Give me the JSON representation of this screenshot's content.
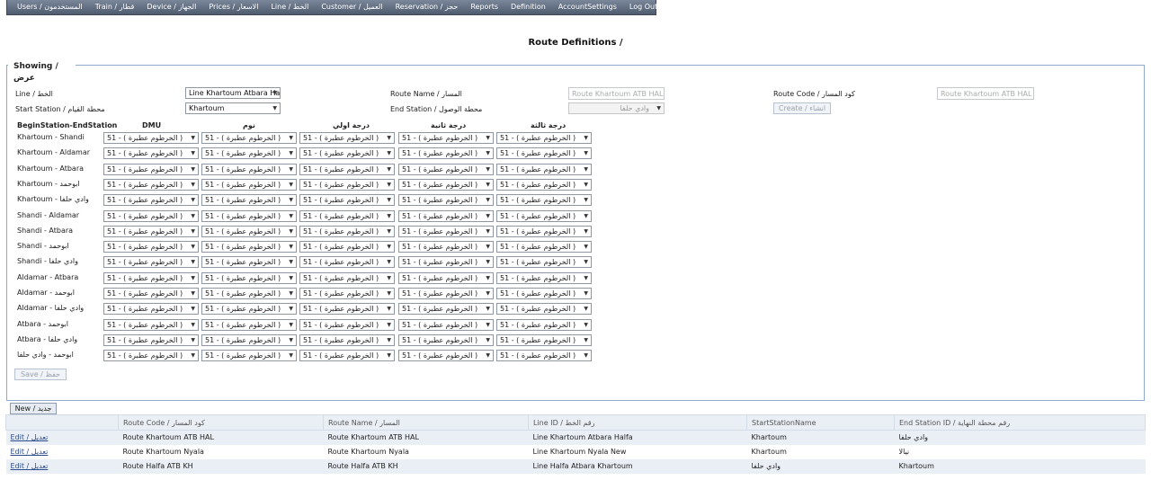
{
  "menu": [
    "Users / المستخدمون",
    "Train / قطار",
    "Device / الجهاز",
    "Prices / الاسعار",
    "Line / الخط",
    "Customer / العميل",
    "Reservation / حجز",
    "Reports",
    "Definition",
    "AccountSettings",
    "Log Out / خروج"
  ],
  "page_title": "Route Definitions /",
  "showing": {
    "legend": "Showing / عرض"
  },
  "form": {
    "line_label": "Line / الخط",
    "line_value": "Line Khartoum Atbara Ha",
    "route_name_label": "Route Name / المسار",
    "route_name_placeholder": "Route Khartoum ATB HAL",
    "route_code_label": "Route Code / كود المسار",
    "route_code_placeholder": "Route Khartoum ATB HAL",
    "start_station_label": "Start Station / محطة القيام",
    "start_station_value": "Khartoum",
    "end_station_label": "End Station / محطة الوصول",
    "end_station_value": "وادي حلفا",
    "create_button": "Create / انشاء",
    "save_button": "Save / حفظ"
  },
  "grid": {
    "headers": [
      "BeginStation-EndStation",
      "DMU",
      "نوم",
      "درجة اولي",
      "درجة ثانية",
      "درجة ثالثة"
    ],
    "cell_value": "51 - ( الخرطوم عطبرة )",
    "rows": [
      "Khartoum - Shandi",
      "Khartoum - Aldamar",
      "Khartoum - Atbara",
      "Khartoum - ابوحمد",
      "Khartoum - وادي حلفا",
      "Shandi - Aldamar",
      "Shandi - Atbara",
      "Shandi - ابوحمد",
      "Shandi - وادي حلفا",
      "Aldamar - Atbara",
      "Aldamar - ابوحمد",
      "Aldamar - وادي حلفا",
      "Atbara - ابوحمد",
      "Atbara - وادي حلفا",
      "ابوحمد - وادي حلفا"
    ]
  },
  "new_button": "New / جديد",
  "results": {
    "headers": [
      "",
      "Route Code / كود المسار",
      "Route Name / المسار",
      "Line ID / رقم الخط",
      "StartStationName",
      "End Station ID / رقم محطة النهاية"
    ],
    "rows": [
      [
        "Edit / تعديل",
        "Route Khartoum ATB HAL",
        "Route Khartoum ATB HAL",
        "Line Khartoum Atbara Halfa",
        "Khartoum",
        "وادي حلفا"
      ],
      [
        "Edit / تعديل",
        "Route Khartoum Nyala",
        "Route Khartoum Nyala",
        "Line Khartoum Nyala New",
        "Khartoum",
        "نيالا"
      ],
      [
        "Edit / تعديل",
        "Route Halfa ATB KH",
        "Route Halfa ATB KH",
        "Line Halfa Atbara Khartoum",
        "وادي حلفا",
        "Khartoum"
      ]
    ]
  }
}
